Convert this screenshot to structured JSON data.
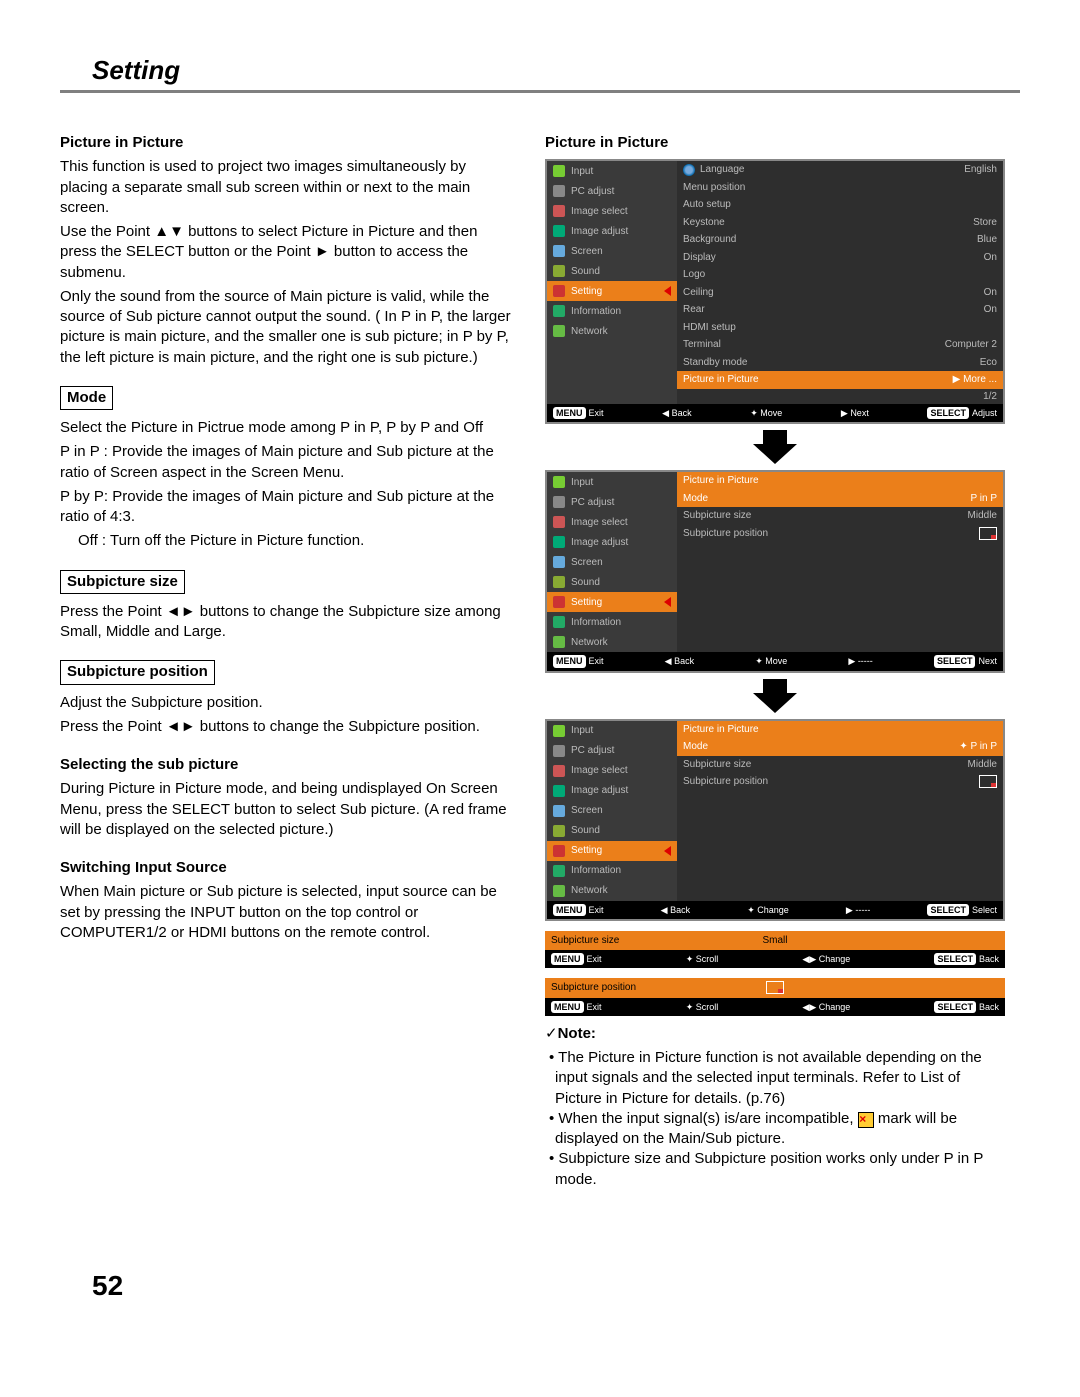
{
  "title": "Setting",
  "page_number": "52",
  "left": {
    "h1": "Picture in Picture",
    "p1": "This function is used to project two images simultaneously by placing a separate small sub screen within or next to the main screen.",
    "p2": "Use the Point ▲▼ buttons to select Picture in Picture and then press the SELECT button or the Point ► button to access the submenu.",
    "p3": "Only the sound from the source of Main picture is valid, while the source of Sub picture cannot output the sound. ( In P in P, the larger picture is main picture, and the smaller one is sub picture; in P by P, the left picture is main picture, and the right one is sub picture.)",
    "mode_h": "Mode",
    "mode_p1": "Select the Picture in Pictrue mode among P in P, P by P and Off",
    "mode_p2": "P in P : Provide the images of Main picture and Sub picture at the ratio of Screen aspect in the Screen Menu.",
    "mode_p3": "P by P: Provide the images of Main picture and Sub picture at the ratio of 4:3.",
    "mode_p4": "Off : Turn off the Picture in Picture function.",
    "size_h": "Subpicture size",
    "size_p": "Press the Point ◄► buttons to change the Subpicture size among Small, Middle and Large.",
    "pos_h": "Subpicture position",
    "pos_p1": "Adjust the Subpicture position.",
    "pos_p2": "Press the Point ◄► buttons to change the Subpicture position.",
    "sel_h": "Selecting the sub picture",
    "sel_p": "During Picture in Picture mode, and being undisplayed On Screen Menu, press the SELECT button to select Sub picture. (A red frame will be displayed on the selected picture.)",
    "sw_h": "Switching Input Source",
    "sw_p": "When Main picture or Sub picture is selected, input source can be set by pressing the INPUT button on the top control or COMPUTER1/2 or HDMI buttons on the remote control."
  },
  "right": {
    "h": "Picture in Picture",
    "note_h": "Note:",
    "note1": "The Picture in Picture function is not available depending on the input signals and the selected input terminals. Refer to List of Picture in Picture for details. (p.76)",
    "note2a": "When the input signal(s) is/are incompatible,",
    "note2b": " mark will be displayed on the Main/Sub picture.",
    "note3": "Subpicture size and Subpicture position works only under P in P mode."
  },
  "side_items": [
    "Input",
    "PC adjust",
    "Image select",
    "Image adjust",
    "Screen",
    "Sound",
    "Setting",
    "Information",
    "Network"
  ],
  "side_colors": [
    "#7c3",
    "#888",
    "#c55",
    "#0a7",
    "#6ad",
    "#8a3",
    "#c33",
    "#2a6",
    "#6b4"
  ],
  "menu1": {
    "title": "Language",
    "title_val": "English",
    "lines": [
      [
        "Menu position",
        ""
      ],
      [
        "Auto setup",
        ""
      ],
      [
        "Keystone",
        "Store"
      ],
      [
        "Background",
        "Blue"
      ],
      [
        "Display",
        "On"
      ],
      [
        "Logo",
        ""
      ],
      [
        "Ceiling",
        "On"
      ],
      [
        "Rear",
        "On"
      ],
      [
        "HDMI setup",
        ""
      ],
      [
        "Terminal",
        "Computer 2"
      ],
      [
        "Standby mode",
        "Eco"
      ]
    ],
    "more": [
      "Picture in Picture",
      "More ..."
    ],
    "page": "1/2",
    "hints": [
      "MENU Exit",
      "◀ Back",
      "✦ Move",
      "▶ Next",
      "SELECT Adjust"
    ]
  },
  "menu2": {
    "title": "Picture in Picture",
    "lines": [
      [
        "Mode",
        "P in P"
      ],
      [
        "Subpicture size",
        "Middle"
      ],
      [
        "Subpicture position",
        ""
      ]
    ],
    "hints": [
      "MENU Exit",
      "◀ Back",
      "✦ Move",
      "▶ -----",
      "SELECT Next"
    ]
  },
  "menu3": {
    "title": "Picture in Picture",
    "lines": [
      [
        "Mode",
        "P in P"
      ],
      [
        "Subpicture size",
        "Middle"
      ],
      [
        "Subpicture position",
        ""
      ]
    ],
    "hints": [
      "MENU Exit",
      "◀ Back",
      "✦ Change",
      "▶ -----",
      "SELECT Select"
    ]
  },
  "bar1": {
    "label": "Subpicture size",
    "val": "Small",
    "hints": [
      "MENU Exit",
      "✦ Scroll",
      "◀▶ Change",
      "SELECT Back"
    ]
  },
  "bar2": {
    "label": "Subpicture position",
    "hints": [
      "MENU Exit",
      "✦ Scroll",
      "◀▶ Change",
      "SELECT Back"
    ]
  }
}
